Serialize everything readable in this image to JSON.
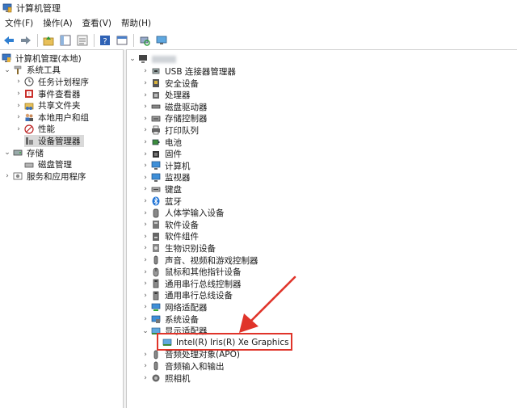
{
  "window": {
    "title": "计算机管理"
  },
  "menu": {
    "file": "文件(F)",
    "action": "操作(A)",
    "view": "查看(V)",
    "help": "帮助(H)"
  },
  "left_tree": [
    {
      "label": "计算机管理(本地)",
      "icon": "computer-mgmt-icon",
      "chev": ""
    },
    {
      "label": "系统工具",
      "icon": "tools-icon",
      "chev": "⌄"
    },
    {
      "label": "任务计划程序",
      "icon": "clock-icon",
      "chev": "›"
    },
    {
      "label": "事件查看器",
      "icon": "event-icon",
      "chev": "›"
    },
    {
      "label": "共享文件夹",
      "icon": "share-icon",
      "chev": "›"
    },
    {
      "label": "本地用户和组",
      "icon": "users-icon",
      "chev": "›"
    },
    {
      "label": "性能",
      "icon": "performance-icon",
      "chev": "›"
    },
    {
      "label": "设备管理器",
      "icon": "device-manager-icon",
      "chev": ""
    },
    {
      "label": "存储",
      "icon": "storage-icon",
      "chev": "⌄"
    },
    {
      "label": "磁盘管理",
      "icon": "disk-icon",
      "chev": ""
    },
    {
      "label": "服务和应用程序",
      "icon": "services-icon",
      "chev": "›"
    }
  ],
  "device_tree": {
    "root_label": "",
    "items": [
      {
        "label": "USB 连接器管理器",
        "icon": "usb-icon",
        "chev": "›"
      },
      {
        "label": "安全设备",
        "icon": "security-icon",
        "chev": "›"
      },
      {
        "label": "处理器",
        "icon": "cpu-icon",
        "chev": "›"
      },
      {
        "label": "磁盘驱动器",
        "icon": "drive-icon",
        "chev": "›"
      },
      {
        "label": "存储控制器",
        "icon": "storage-ctrl-icon",
        "chev": "›"
      },
      {
        "label": "打印队列",
        "icon": "printer-icon",
        "chev": "›"
      },
      {
        "label": "电池",
        "icon": "battery-icon",
        "chev": "›"
      },
      {
        "label": "固件",
        "icon": "firmware-icon",
        "chev": "›"
      },
      {
        "label": "计算机",
        "icon": "monitor-icon",
        "chev": "›"
      },
      {
        "label": "监视器",
        "icon": "monitor-icon",
        "chev": "›"
      },
      {
        "label": "键盘",
        "icon": "keyboard-icon",
        "chev": "›"
      },
      {
        "label": "蓝牙",
        "icon": "bluetooth-icon",
        "chev": "›"
      },
      {
        "label": "人体学输入设备",
        "icon": "hid-icon",
        "chev": "›"
      },
      {
        "label": "软件设备",
        "icon": "software-icon",
        "chev": "›"
      },
      {
        "label": "软件组件",
        "icon": "component-icon",
        "chev": "›"
      },
      {
        "label": "生物识别设备",
        "icon": "biometric-icon",
        "chev": "›"
      },
      {
        "label": "声音、视频和游戏控制器",
        "icon": "sound-icon",
        "chev": "›"
      },
      {
        "label": "鼠标和其他指针设备",
        "icon": "mouse-icon",
        "chev": "›"
      },
      {
        "label": "通用串行总线控制器",
        "icon": "usb-ctrl-icon",
        "chev": "›"
      },
      {
        "label": "通用串行总线设备",
        "icon": "usb-ctrl-icon",
        "chev": "›"
      },
      {
        "label": "网络适配器",
        "icon": "network-icon",
        "chev": "›"
      },
      {
        "label": "系统设备",
        "icon": "system-icon",
        "chev": "›"
      },
      {
        "label": "显示适配器",
        "icon": "display-icon",
        "chev": "⌄"
      },
      {
        "label": "Intel(R) Iris(R) Xe Graphics",
        "icon": "display-icon",
        "chev": "",
        "child": true
      },
      {
        "label": "音频处理对象(APO)",
        "icon": "audio-icon",
        "chev": "›"
      },
      {
        "label": "音频输入和输出",
        "icon": "audio-icon",
        "chev": "›"
      },
      {
        "label": "照相机",
        "icon": "camera-icon",
        "chev": "›"
      }
    ]
  },
  "colors": {
    "accent": "#e0342a",
    "selection": "#d9d9d9"
  }
}
